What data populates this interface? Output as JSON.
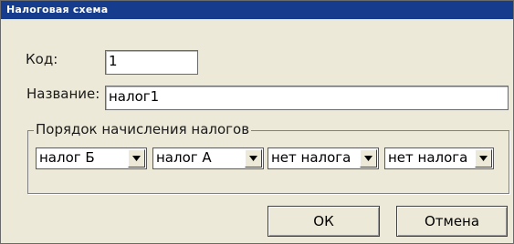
{
  "window": {
    "title": "Налоговая схема"
  },
  "form": {
    "code_label": "Код:",
    "code_value": "1",
    "name_label": "Название:",
    "name_value": "налог1"
  },
  "tax_order": {
    "legend": "Порядок начисления налогов",
    "selects": [
      {
        "value": "налог Б"
      },
      {
        "value": "налог А"
      },
      {
        "value": "нет налога"
      },
      {
        "value": "нет налога"
      }
    ]
  },
  "buttons": {
    "ok_label": "ОК",
    "cancel_label": "Отмена"
  },
  "colors": {
    "titlebar": "#163d8d",
    "dialog_bg": "#ece9d8"
  }
}
